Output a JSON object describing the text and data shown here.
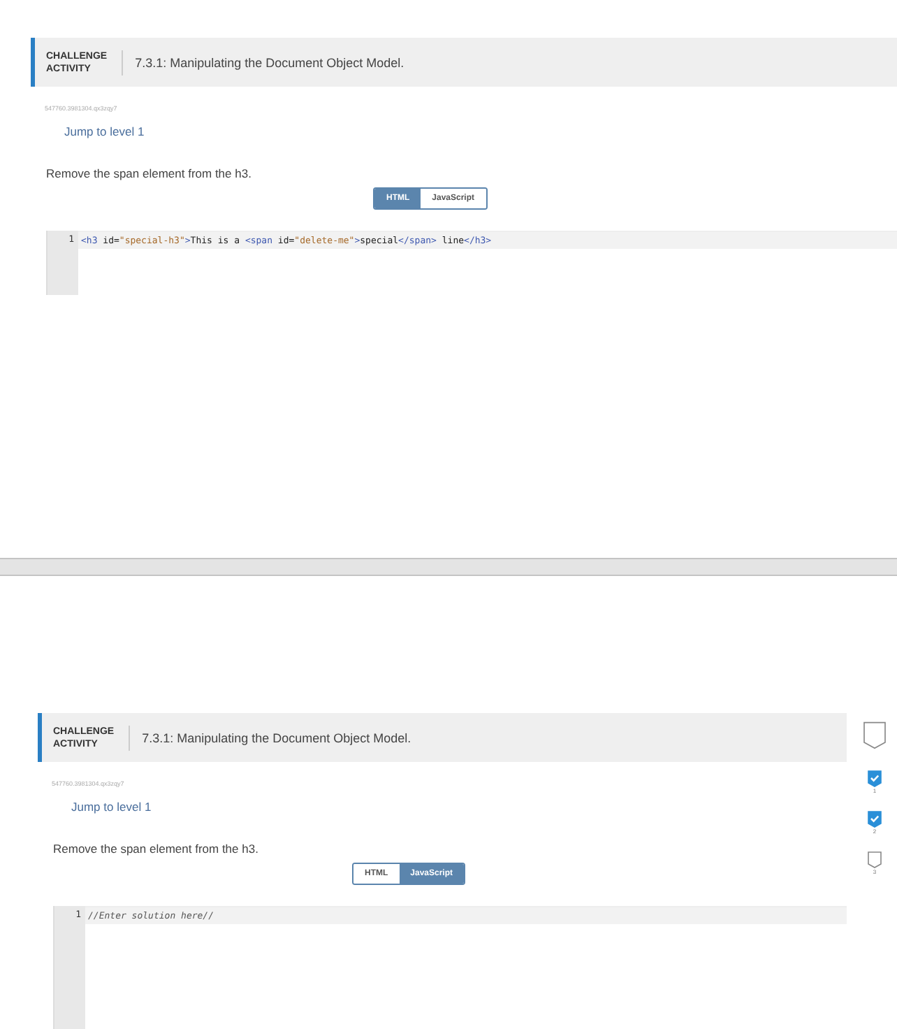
{
  "activities": [
    {
      "badge": [
        "CHALLENGE",
        "ACTIVITY"
      ],
      "title": "7.3.1: Manipulating the Document Object Model.",
      "id_text": "547760.3981304.qx3zqy7",
      "jump_link": "Jump to level 1",
      "instruction": "Remove the span element from the h3.",
      "tabs": [
        {
          "label": "HTML",
          "selected": true
        },
        {
          "label": "JavaScript",
          "selected": false
        }
      ],
      "code_lines": [
        {
          "number": "1",
          "tokens": [
            {
              "kind": "tag",
              "text": "<h3"
            },
            {
              "kind": "plain",
              "text": " id="
            },
            {
              "kind": "string",
              "text": "\"special-h3\""
            },
            {
              "kind": "tag",
              "text": ">"
            },
            {
              "kind": "plain",
              "text": "This is a "
            },
            {
              "kind": "tag",
              "text": "<span"
            },
            {
              "kind": "plain",
              "text": " id="
            },
            {
              "kind": "string",
              "text": "\"delete-me\""
            },
            {
              "kind": "tag",
              "text": ">"
            },
            {
              "kind": "plain",
              "text": "special"
            },
            {
              "kind": "tag",
              "text": "</span>"
            },
            {
              "kind": "plain",
              "text": " line"
            },
            {
              "kind": "tag",
              "text": "</h3>"
            }
          ]
        }
      ]
    },
    {
      "badge": [
        "CHALLENGE",
        "ACTIVITY"
      ],
      "title": "7.3.1: Manipulating the Document Object Model.",
      "id_text": "547760.3981304.qx3zqy7",
      "jump_link": "Jump to level 1",
      "instruction": "Remove the span element from the h3.",
      "tabs": [
        {
          "label": "HTML",
          "selected": false
        },
        {
          "label": "JavaScript",
          "selected": true
        }
      ],
      "code_lines": [
        {
          "number": "1",
          "tokens": [
            {
              "kind": "comment",
              "text": "//Enter solution here//"
            }
          ]
        }
      ],
      "levels": [
        {
          "label": "1",
          "done": true
        },
        {
          "label": "2",
          "done": true
        },
        {
          "label": "3",
          "done": false
        }
      ]
    }
  ]
}
